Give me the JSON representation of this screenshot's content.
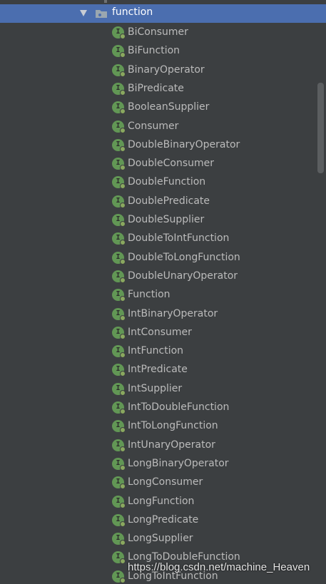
{
  "tree": {
    "folder": {
      "label": "function",
      "icon": "package-folder-icon",
      "expanded": true
    },
    "items": [
      {
        "label": "BiConsumer",
        "icon": "interface-icon"
      },
      {
        "label": "BiFunction",
        "icon": "interface-icon"
      },
      {
        "label": "BinaryOperator",
        "icon": "interface-icon"
      },
      {
        "label": "BiPredicate",
        "icon": "interface-icon"
      },
      {
        "label": "BooleanSupplier",
        "icon": "interface-icon"
      },
      {
        "label": "Consumer",
        "icon": "interface-icon"
      },
      {
        "label": "DoubleBinaryOperator",
        "icon": "interface-icon"
      },
      {
        "label": "DoubleConsumer",
        "icon": "interface-icon"
      },
      {
        "label": "DoubleFunction",
        "icon": "interface-icon"
      },
      {
        "label": "DoublePredicate",
        "icon": "interface-icon"
      },
      {
        "label": "DoubleSupplier",
        "icon": "interface-icon"
      },
      {
        "label": "DoubleToIntFunction",
        "icon": "interface-icon"
      },
      {
        "label": "DoubleToLongFunction",
        "icon": "interface-icon"
      },
      {
        "label": "DoubleUnaryOperator",
        "icon": "interface-icon"
      },
      {
        "label": "Function",
        "icon": "interface-icon"
      },
      {
        "label": "IntBinaryOperator",
        "icon": "interface-icon"
      },
      {
        "label": "IntConsumer",
        "icon": "interface-icon"
      },
      {
        "label": "IntFunction",
        "icon": "interface-icon"
      },
      {
        "label": "IntPredicate",
        "icon": "interface-icon"
      },
      {
        "label": "IntSupplier",
        "icon": "interface-icon"
      },
      {
        "label": "IntToDoubleFunction",
        "icon": "interface-icon"
      },
      {
        "label": "IntToLongFunction",
        "icon": "interface-icon"
      },
      {
        "label": "IntUnaryOperator",
        "icon": "interface-icon"
      },
      {
        "label": "LongBinaryOperator",
        "icon": "interface-icon"
      },
      {
        "label": "LongConsumer",
        "icon": "interface-icon"
      },
      {
        "label": "LongFunction",
        "icon": "interface-icon"
      },
      {
        "label": "LongPredicate",
        "icon": "interface-icon"
      },
      {
        "label": "LongSupplier",
        "icon": "interface-icon"
      },
      {
        "label": "LongToDoubleFunction",
        "icon": "interface-icon"
      },
      {
        "label": "LongToIntFunction",
        "icon": "interface-icon"
      }
    ]
  },
  "icon_glyph": "I",
  "watermark": "https://blog.csdn.net/machine_Heaven",
  "colors": {
    "background": "#3c3f41",
    "selection": "#4b6eaf",
    "text": "#bbbbbb",
    "interface_icon": "#629755"
  }
}
